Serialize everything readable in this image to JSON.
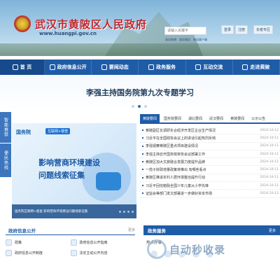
{
  "header": {
    "site_title": "武汉市黄陂区人民政府",
    "site_url": "www.huangpi.gov.cn",
    "search_placeholder": "请输入关键字",
    "login_label": "登录",
    "register_label": "注册",
    "elder_label": "长者专区",
    "sub_links": [
      "政务微博",
      "政务微信",
      "移动客户端"
    ]
  },
  "nav": {
    "items": [
      {
        "label": "首    页"
      },
      {
        "label": "政府信息公开"
      },
      {
        "label": "要闻动态"
      },
      {
        "label": "政务服务"
      },
      {
        "label": "互动交流"
      },
      {
        "label": "走进黄陂"
      }
    ]
  },
  "banner": {
    "title": "李强主持国务院第九次专题学习"
  },
  "side_buttons": [
    "智能推荐",
    "便民热线"
  ],
  "promo": {
    "label": "国务院",
    "tag": "互联网+督查",
    "heading_line1": "影响营商环境建设",
    "heading_line2": "问题线索征集",
    "caption": "国务院互联网+督查 影响营商环境建设问题线索征集"
  },
  "news": {
    "tabs": [
      "黄陂要闻",
      "国务院要闻",
      "湖北要闻",
      "武汉要闻",
      "黄陂要闻",
      "公示公告"
    ],
    "items": [
      {
        "title": "黄陂副区长调研东合经济开发区企业生产情况",
        "date": "2024-10-12"
      },
      {
        "title": "习近平在全国政协会议上的讲话引起热烈反响",
        "date": "2024-10-11"
      },
      {
        "title": "李强视察黄陂区重点项目建设情况",
        "date": "2024-10-11"
      },
      {
        "title": "李强主持召开国务院常务会议部署工作",
        "date": "2024-10-11"
      },
      {
        "title": "黄陂区加大文旅融合发展力度提升品牌",
        "date": "2024-10-11"
      },
      {
        "title": "一揽子财政增量政策将推出 有哪些看点",
        "date": "2024-10-11"
      },
      {
        "title": "黄陂区推进农村人居环境整治提升行动",
        "date": "2024-10-11"
      },
      {
        "title": "习近平回信勉励全国少年儿童从小学先锋",
        "date": "2024-10-11"
      },
      {
        "title": "证监会等部门发文部署进一步做好资本市场",
        "date": "2024-10-12"
      }
    ]
  },
  "info_panel": {
    "title": "政府信息公开",
    "more": "更多",
    "items": [
      "政策",
      "政府信息公开指南",
      "政府信息公开制度",
      "法定主动公开内容"
    ]
  },
  "service_panel": {
    "title": "政务服务",
    "tab": "更多",
    "sub": "热点办事"
  },
  "watermark": {
    "text": "自动秒收录"
  }
}
